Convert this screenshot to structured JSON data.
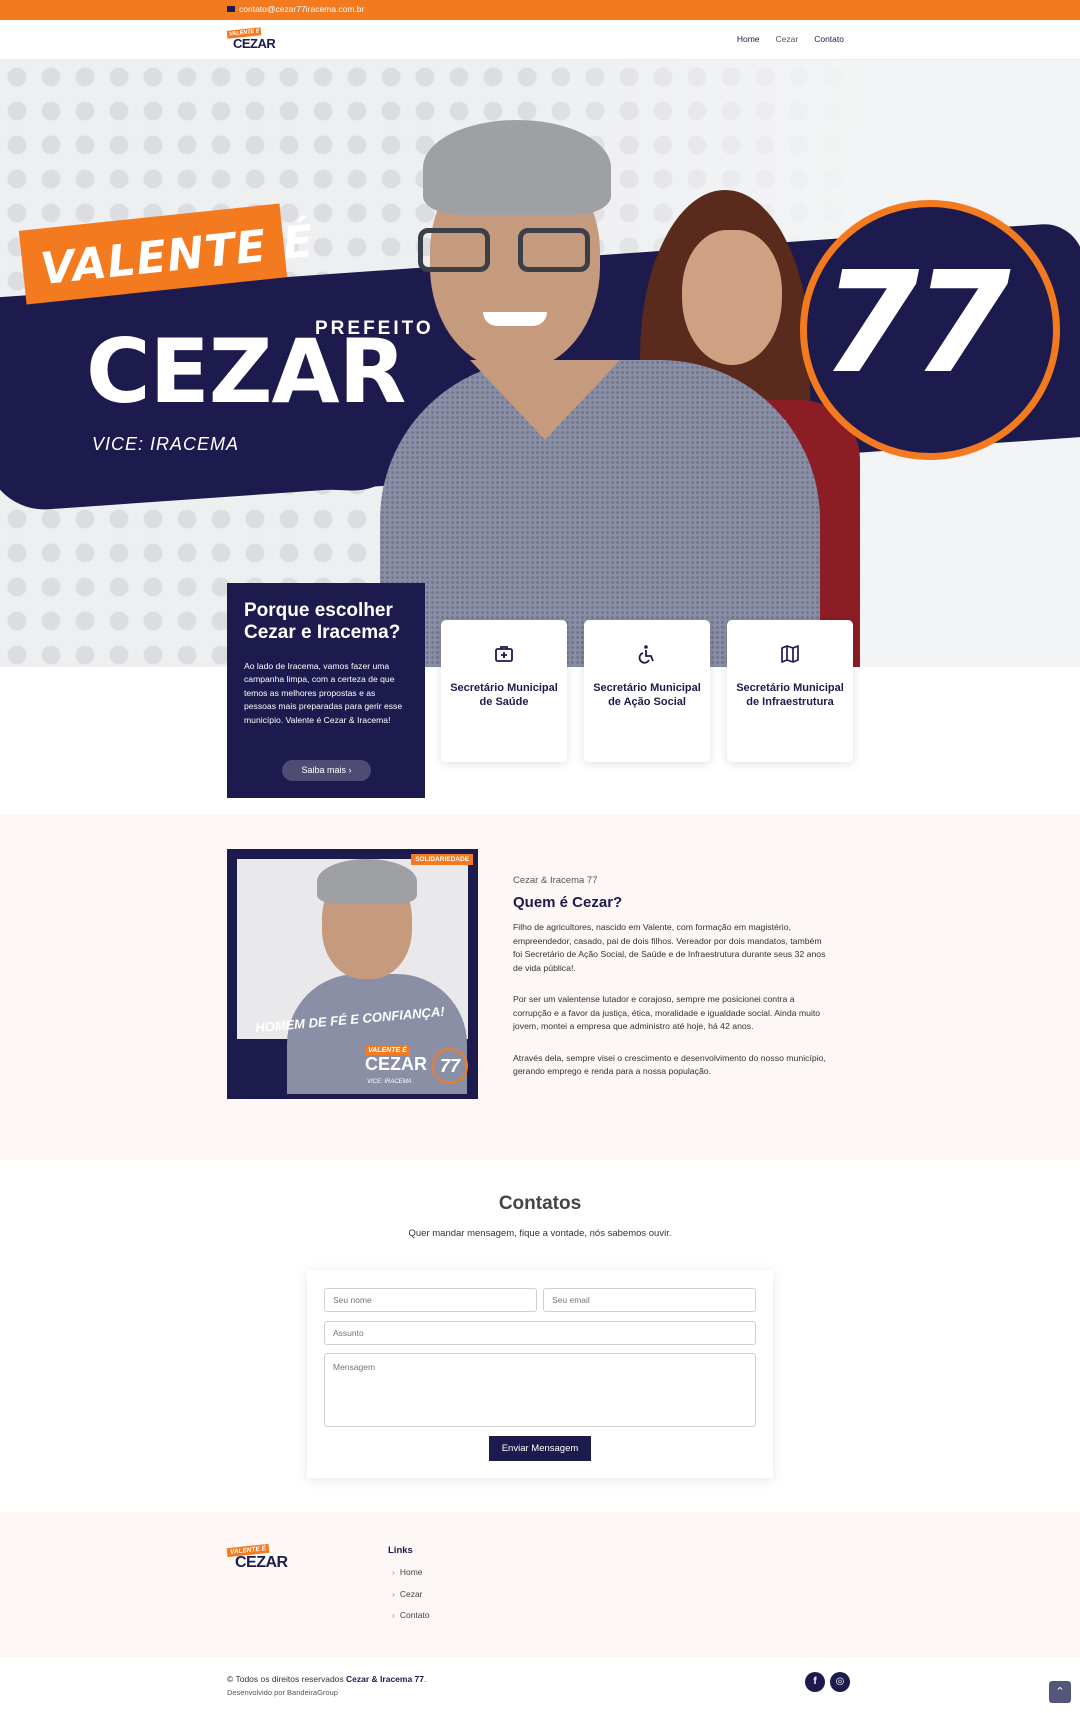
{
  "topbar": {
    "email": "contato@cezar77iracema.com.br"
  },
  "header": {
    "logo_top": "VALENTE É",
    "logo_main": "CEZAR",
    "nav": [
      "Home",
      "Cezar",
      "Contato"
    ]
  },
  "hero": {
    "slogan": "VALENTE É",
    "role": "PREFEITO",
    "name": "CEZAR",
    "vice": "VICE: IRACEMA",
    "number": "77"
  },
  "why": {
    "title": "Porque escolher Cezar e Iracema?",
    "text": "Ao lado de Iracema, vamos fazer uma campanha limpa, com a certeza de que temos as melhores propostas e as pessoas mais preparadas para gerir esse município. Valente é Cezar & Iracema!",
    "button": "Saiba mais ›"
  },
  "cards": [
    {
      "icon": "medical-kit-icon",
      "label": "Secretário Municipal de Saúde"
    },
    {
      "icon": "wheelchair-icon",
      "label": "Secretário Municipal de Ação Social"
    },
    {
      "icon": "map-icon",
      "label": "Secretário Municipal de Infraestrutura"
    }
  ],
  "about": {
    "image_tag": "SOLIDARIEDADE",
    "image_slogan": "HOMEM DE FÉ E CONFIANÇA!",
    "image_valente": "VALENTE É",
    "image_name": "CEZAR",
    "image_number": "77",
    "image_vice": "VICE: IRACEMA",
    "eyebrow": "Cezar & Iracema 77",
    "title": "Quem é Cezar?",
    "p1": "Filho de agricultores, nascido em Valente, com formação em magistério, empreendedor, casado, pai de dois filhos. Vereador por dois mandatos, também foi Secretário de Ação Social, de Saúde e de Infraestrutura durante seus 32 anos de vida pública!.",
    "p2": "Por ser um valentense lutador e corajoso, sempre me posicionei contra a corrupção e a favor da justiça, ética, moralidade e igualdade social. Ainda muito jovem, montei a empresa que administro até hoje, há 42 anos.",
    "p3": "Através dela, sempre visei o crescimento e desenvolvimento do nosso município, gerando emprego e renda para a nossa população."
  },
  "contacts": {
    "title": "Contatos",
    "subtitle": "Quer mandar mensagem, fique a vontade, nós sabemos ouvir.",
    "name_placeholder": "Seu nome",
    "email_placeholder": "Seu email",
    "subject_placeholder": "Assunto",
    "message_placeholder": "Mensagem",
    "send": "Enviar Mensagem"
  },
  "footer": {
    "logo_top": "VALENTE É",
    "logo_main": "CEZAR",
    "links_title": "Links",
    "links": [
      "Home",
      "Cezar",
      "Contato"
    ],
    "copyright_prefix": "© Todos os direitos reservados ",
    "copyright_brand": "Cezar & Iracema 77",
    "copyright_suffix": ".",
    "dev_prefix": "Desenvolvido por ",
    "dev_name": "BandeiraGroup",
    "social": [
      "f",
      "◎"
    ],
    "to_top": "⌃"
  },
  "colors": {
    "orange": "#f47a20",
    "navy": "#1d1b4e"
  }
}
